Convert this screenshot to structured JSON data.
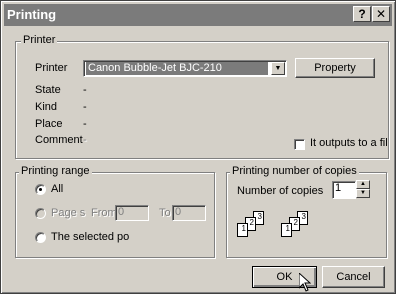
{
  "window": {
    "title": "Printing",
    "help_glyph": "?",
    "close_glyph": "✕"
  },
  "printer_group": {
    "legend": "Printer",
    "printer_label": "Printer",
    "printer_value": "Canon Bubble-Jet BJC-210",
    "property_button": "Property",
    "state_label": "State",
    "state_value": "-",
    "kind_label": "Kind",
    "kind_value": "-",
    "place_label": "Place",
    "place_value": "-",
    "comment_label": "Comment",
    "comment_value": "-",
    "outputs_to_file_label": "It outputs to a file"
  },
  "range_group": {
    "legend": "Printing range",
    "all_label": "All",
    "pages_label": "Page s",
    "from_label": "From",
    "from_value": "0",
    "to_label": "To",
    "to_value": "0",
    "selected_label": "The selected po",
    "selected_option": "All"
  },
  "copies_group": {
    "legend": "Printing number of copies",
    "number_label": "Number of copies",
    "number_value": "1",
    "collate_pages": [
      "1",
      "2",
      "3"
    ]
  },
  "buttons": {
    "ok": "OK",
    "cancel": "Cancel"
  },
  "colors": {
    "face": "#d4d0c8",
    "titlebar": "#7b7b7b",
    "selection": "#7b7b7b"
  },
  "icons": {
    "help": "help-icon",
    "close": "close-icon",
    "dropdown": "dropdown-arrow-icon",
    "cursor": "mouse-cursor-icon"
  }
}
